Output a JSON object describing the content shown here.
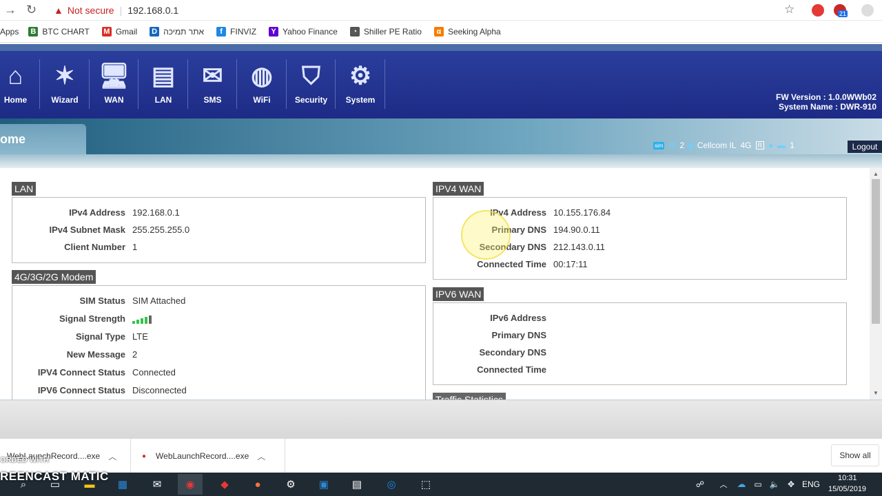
{
  "browser": {
    "security_label": "Not secure",
    "url": "192.168.0.1",
    "ext_badge": "21"
  },
  "bookmarks": [
    {
      "label": "Apps",
      "icon": "apps-icon",
      "color": "#1a73e8"
    },
    {
      "label": "BTC CHART",
      "icon": "bookmark-b-icon",
      "color": "#2e7d32"
    },
    {
      "label": "Gmail",
      "icon": "gmail-icon",
      "color": "#d93025"
    },
    {
      "label": "אתר תמיכה",
      "icon": "support-site-icon",
      "color": "#1565c0"
    },
    {
      "label": "FINVIZ",
      "icon": "finviz-icon",
      "color": "#1e88e5"
    },
    {
      "label": "Yahoo Finance",
      "icon": "yahoo-icon",
      "color": "#6001d2"
    },
    {
      "label": "Shiller PE Ratio",
      "icon": "shiller-icon",
      "color": "#555"
    },
    {
      "label": "Seeking Alpha",
      "icon": "seeking-alpha-icon",
      "color": "#f57c00"
    }
  ],
  "nav": [
    {
      "label": "Home",
      "icon": "home-icon"
    },
    {
      "label": "Wizard",
      "icon": "wizard-icon"
    },
    {
      "label": "WAN",
      "icon": "wan-icon"
    },
    {
      "label": "LAN",
      "icon": "lan-icon"
    },
    {
      "label": "SMS",
      "icon": "sms-icon"
    },
    {
      "label": "WiFi",
      "icon": "wifi-icon"
    },
    {
      "label": "Security",
      "icon": "security-icon"
    },
    {
      "label": "System",
      "icon": "system-icon"
    }
  ],
  "device": {
    "fw_version": "FW Version : 1.0.0WWb02",
    "system_name": "System Name : DWR-910"
  },
  "page": {
    "title": "ome"
  },
  "status": {
    "sms_count": "2",
    "carrier": "Cellcom IL",
    "network": "4G",
    "roaming": "R",
    "clients": "1",
    "logout": "Logout"
  },
  "lan": {
    "title": "LAN",
    "rows": [
      {
        "k": "IPv4 Address",
        "v": "192.168.0.1"
      },
      {
        "k": "IPv4 Subnet Mask",
        "v": "255.255.255.0"
      },
      {
        "k": "Client Number",
        "v": "1"
      }
    ]
  },
  "modem": {
    "title": "4G/3G/2G Modem",
    "rows": [
      {
        "k": "SIM Status",
        "v": "SIM Attached"
      },
      {
        "k": "Signal Strength",
        "v": ""
      },
      {
        "k": "Signal Type",
        "v": "LTE"
      },
      {
        "k": "New Message",
        "v": "2"
      },
      {
        "k": "IPV4 Connect Status",
        "v": "Connected"
      },
      {
        "k": "IPV6 Connect Status",
        "v": "Disconnected"
      }
    ],
    "signal_bars": 4,
    "signal_max": 5
  },
  "ipv4wan": {
    "title": "IPV4 WAN",
    "rows": [
      {
        "k": "IPv4 Address",
        "v": "10.155.176.84"
      },
      {
        "k": "Primary DNS",
        "v": "194.90.0.11"
      },
      {
        "k": "Secondary DNS",
        "v": "212.143.0.11"
      },
      {
        "k": "Connected Time",
        "v": "00:17:11"
      }
    ]
  },
  "ipv6wan": {
    "title": "IPV6 WAN",
    "rows": [
      {
        "k": "IPv6 Address",
        "v": ""
      },
      {
        "k": "Primary DNS",
        "v": ""
      },
      {
        "k": "Secondary DNS",
        "v": ""
      },
      {
        "k": "Connected Time",
        "v": ""
      }
    ]
  },
  "traffic": {
    "title": "Traffic Statistics"
  },
  "downloads": {
    "items": [
      {
        "name": "WebLaunchRecord....exe"
      },
      {
        "name": "WebLaunchRecord....exe"
      }
    ],
    "show_all": "Show all"
  },
  "watermark": {
    "line1": "ORDED WITH",
    "line2": "REENCAST MATIC"
  },
  "taskbar": {
    "lang": "ENG",
    "time": "10:31",
    "date": "15/05/2019"
  }
}
